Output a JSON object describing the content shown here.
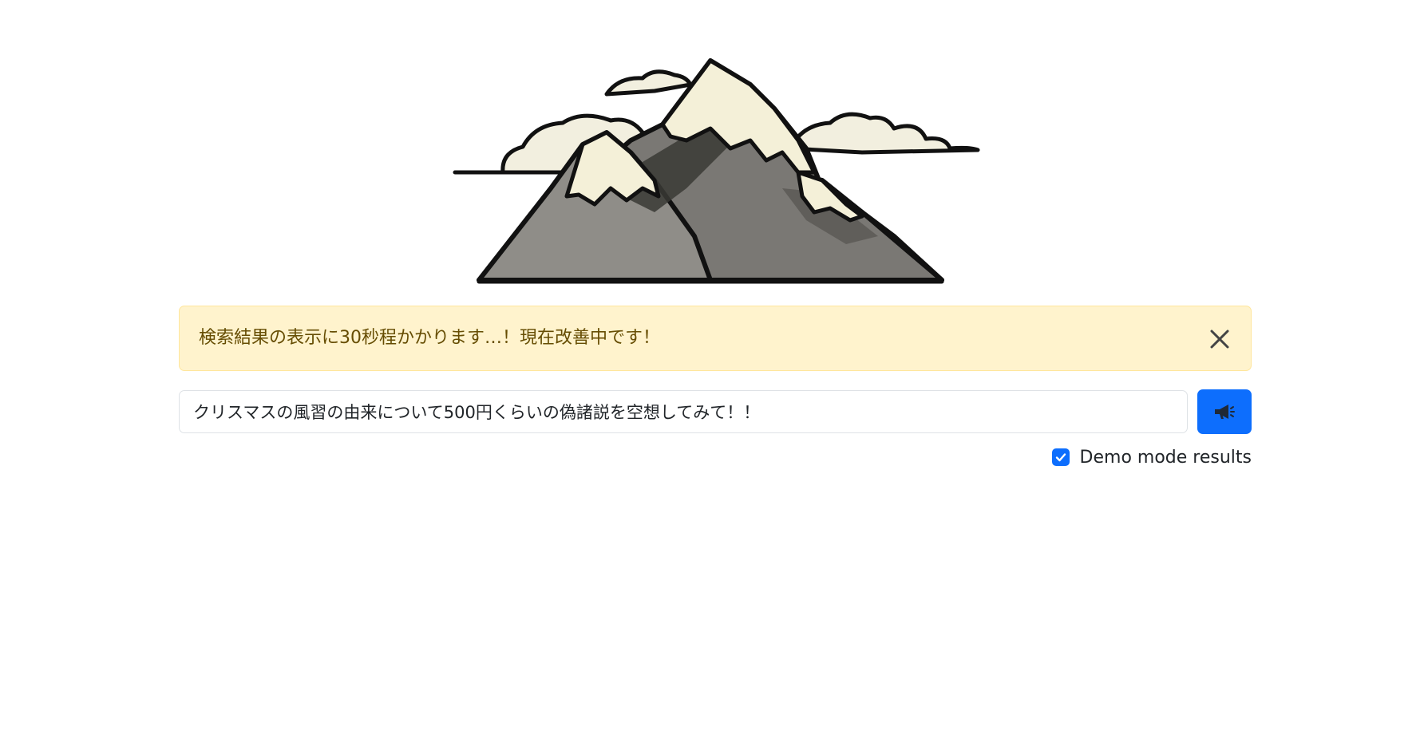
{
  "logo": {
    "name": "mountain-logo"
  },
  "alert": {
    "message": "検索結果の表示に30秒程かかります…！現在改善中です！",
    "close_icon": "close-icon"
  },
  "search": {
    "value": "クリスマスの風習の由来について500円くらいの偽諸説を空想してみて！！",
    "submit_icon": "megaphone-icon"
  },
  "demo_mode": {
    "label": "Demo mode results",
    "checked": true
  },
  "colors": {
    "primary": "#0d6efd",
    "alert_bg": "#fff3cd",
    "alert_border": "#ffe69c",
    "alert_text": "#664d03"
  }
}
